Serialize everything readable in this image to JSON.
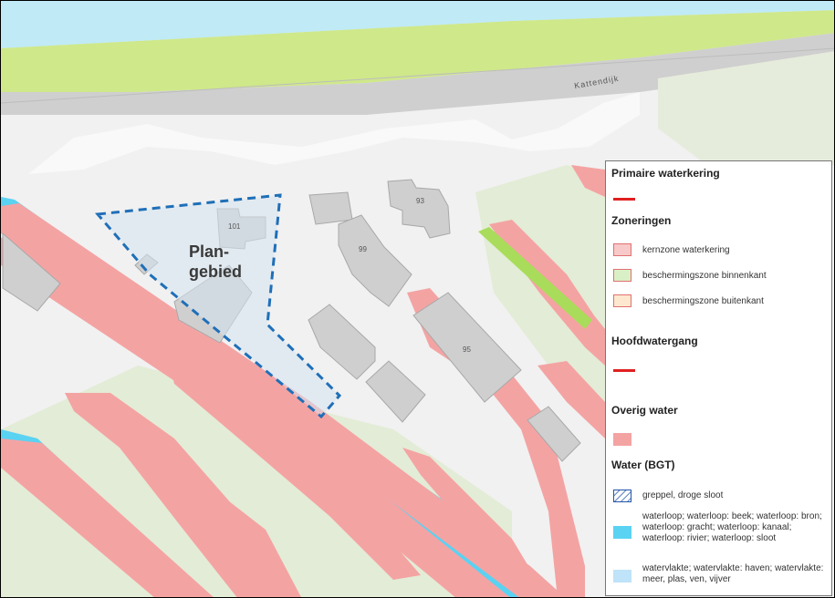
{
  "map": {
    "road_name": "Kattendijk",
    "plan_label_line1": "Plan-",
    "plan_label_line2": "gebied",
    "building_numbers": [
      "101",
      "99",
      "93",
      "95"
    ]
  },
  "legend": {
    "primaire_waterkering": {
      "title": "Primaire waterkering",
      "color": "#e02020"
    },
    "zoneringen": {
      "title": "Zoneringen",
      "items": [
        {
          "label": "kernzone waterkering",
          "fill": "#f8c9c9",
          "stroke": "#e07070"
        },
        {
          "label": "beschermingszone binnenkant",
          "fill": "#d9f0c6",
          "stroke": "#e07070"
        },
        {
          "label": "beschermingszone buitenkant",
          "fill": "#fde8cf",
          "stroke": "#e07070"
        }
      ]
    },
    "hoofdwatergang": {
      "title": "Hoofdwatergang",
      "color": "#e02020"
    },
    "overig_water": {
      "title": "Overig water",
      "color": "#f4a3a3"
    },
    "water_bgt": {
      "title": "Water (BGT)",
      "items": [
        {
          "label": "greppel, droge sloot"
        },
        {
          "label": "waterloop; waterloop: beek; waterloop: bron; waterloop: gracht; waterloop: kanaal; waterloop: rivier; waterloop: sloot",
          "fill": "#5ad2f2"
        },
        {
          "label": "watervlakte; watervlakte: haven; watervlakte: meer, plas, ven, vijver",
          "fill": "#bfe3f8"
        }
      ]
    }
  }
}
